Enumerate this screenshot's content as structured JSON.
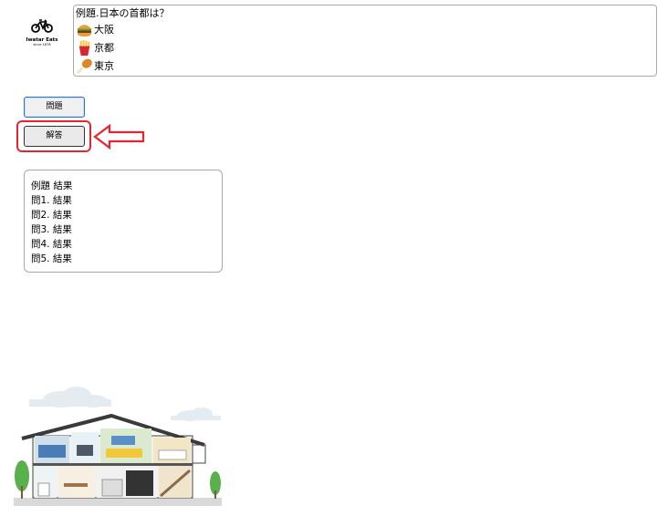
{
  "logo": {
    "brand": "Iwatar Eats",
    "since": "since 1878",
    "icon": "bicycle-icon"
  },
  "question": {
    "title": "例題.日本の首都は？",
    "options": [
      {
        "label": "大阪",
        "icon": "hamburger-icon"
      },
      {
        "label": "京都",
        "icon": "french-fries-icon"
      },
      {
        "label": "東京",
        "icon": "chicken-leg-icon"
      }
    ]
  },
  "buttons": {
    "question_label": "問題",
    "answer_label": "解答"
  },
  "results": {
    "lines": [
      "例題 結果",
      "問1. 結果",
      "問2. 結果",
      "問3. 結果",
      "問4. 結果",
      "問5. 結果"
    ]
  },
  "colors": {
    "highlight": "#e8242f",
    "focus_border": "#2a6fd1"
  },
  "illustration": "house-cutaway-illustration"
}
